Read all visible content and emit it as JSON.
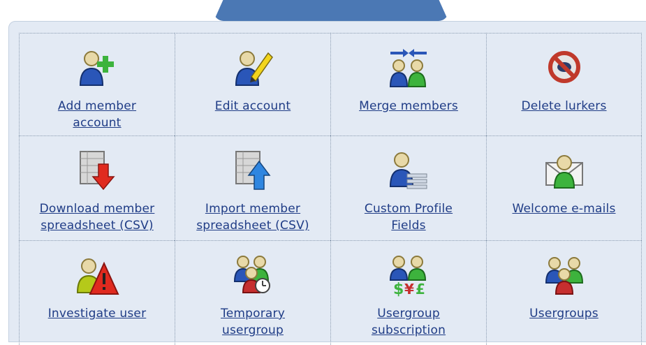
{
  "items": [
    {
      "label": "Add member\naccount",
      "icon": "add-member-icon"
    },
    {
      "label": "Edit account",
      "icon": "edit-account-icon"
    },
    {
      "label": "Merge members",
      "icon": "merge-members-icon"
    },
    {
      "label": "Delete lurkers",
      "icon": "delete-lurkers-icon"
    },
    {
      "label": "Download member\nspreadsheet (CSV)",
      "icon": "download-csv-icon"
    },
    {
      "label": "Import member\nspreadsheet (CSV)",
      "icon": "import-csv-icon"
    },
    {
      "label": "Custom Profile\nFields",
      "icon": "custom-profile-fields-icon"
    },
    {
      "label": "Welcome e-mails",
      "icon": "welcome-emails-icon"
    },
    {
      "label": "Investigate user",
      "icon": "investigate-user-icon"
    },
    {
      "label": "Temporary\nusergroup",
      "icon": "temporary-usergroup-icon"
    },
    {
      "label": "Usergroup\nsubscription",
      "icon": "usergroup-subscription-icon"
    },
    {
      "label": "Usergroups",
      "icon": "usergroups-icon"
    }
  ],
  "colors": {
    "link": "#1f3c86",
    "tab": "#4b78b4",
    "panel": "#e3eaf4"
  }
}
